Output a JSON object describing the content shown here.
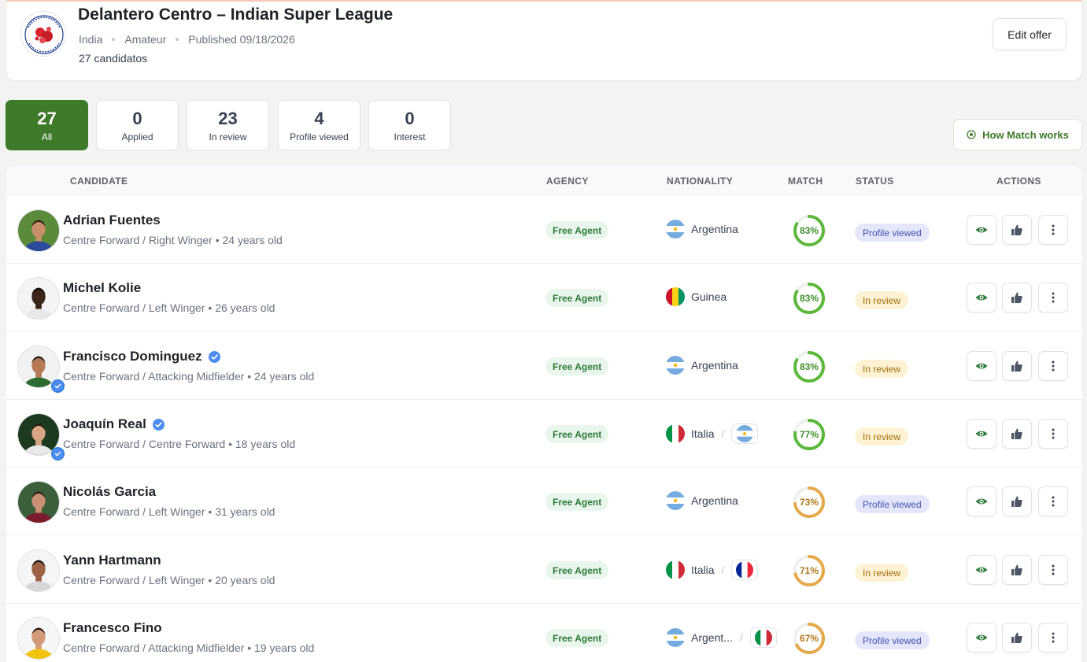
{
  "offer": {
    "title": "Delantero Centro – Indian Super League",
    "country": "India",
    "level": "Amateur",
    "published": "Published 09/18/2026",
    "candidates_count": "27 candidatos",
    "edit_label": "Edit offer",
    "logo_icon": "indian-super-league-logo"
  },
  "filters": [
    {
      "count": "27",
      "label": "All",
      "active": true
    },
    {
      "count": "0",
      "label": "Applied",
      "active": false
    },
    {
      "count": "23",
      "label": "In review",
      "active": false
    },
    {
      "count": "4",
      "label": "Profile viewed",
      "active": false
    },
    {
      "count": "0",
      "label": "Interest",
      "active": false
    }
  ],
  "how_match_label": "How Match works",
  "table": {
    "headers": {
      "candidate": "CANDIDATE",
      "agency": "AGENCY",
      "nationality": "NATIONALITY",
      "match": "MATCH",
      "status": "STATUS",
      "actions": "ACTIONS"
    },
    "rows": [
      {
        "name": "Adrian Fuentes",
        "subtitle": "Centre Forward / Right Winger • 24 years old",
        "verified": false,
        "agency": "Free Agent",
        "nationality": "Argentina",
        "flags": [
          "argentina"
        ],
        "match": "83%",
        "match_value": 83,
        "status": "Profile viewed",
        "status_type": "viewed"
      },
      {
        "name": "Michel Kolie",
        "subtitle": "Centre Forward / Left Winger • 26 years old",
        "verified": false,
        "agency": "Free Agent",
        "nationality": "Guinea",
        "flags": [
          "guinea"
        ],
        "match": "83%",
        "match_value": 83,
        "status": "In review",
        "status_type": "review"
      },
      {
        "name": "Francisco Dominguez",
        "subtitle": "Centre Forward / Attacking Midfielder • 24 years old",
        "verified": true,
        "agency": "Free Agent",
        "nationality": "Argentina",
        "flags": [
          "argentina"
        ],
        "match": "83%",
        "match_value": 83,
        "status": "In review",
        "status_type": "review"
      },
      {
        "name": "Joaquín Real",
        "subtitle": "Centre Forward / Centre Forward • 18 years old",
        "verified": true,
        "agency": "Free Agent",
        "nationality": "Italia",
        "flags": [
          "italy",
          "argentina"
        ],
        "match": "77%",
        "match_value": 77,
        "status": "In review",
        "status_type": "review"
      },
      {
        "name": "Nicolás Garcia",
        "subtitle": "Centre Forward / Left Winger • 31 years old",
        "verified": false,
        "agency": "Free Agent",
        "nationality": "Argentina",
        "flags": [
          "argentina"
        ],
        "match": "73%",
        "match_value": 73,
        "status": "Profile viewed",
        "status_type": "viewed"
      },
      {
        "name": "Yann Hartmann",
        "subtitle": "Centre Forward / Left Winger • 20 years old",
        "verified": false,
        "agency": "Free Agent",
        "nationality": "Italia",
        "flags": [
          "italy",
          "france"
        ],
        "match": "71%",
        "match_value": 71,
        "status": "In review",
        "status_type": "review"
      },
      {
        "name": "Francesco Fino",
        "subtitle": "Centre Forward / Attacking Midfielder • 19 years old",
        "verified": false,
        "agency": "Free Agent",
        "nationality": "Argent...",
        "flags": [
          "argentina",
          "italy"
        ],
        "match": "67%",
        "match_value": 67,
        "status": "Profile viewed",
        "status_type": "viewed"
      }
    ]
  },
  "colors": {
    "brand_green": "#3d7a2a",
    "match_high": "#5cb83a",
    "match_mid": "#e5a94a"
  },
  "row_actions": [
    "eye-icon",
    "thumbs-up-icon",
    "more-vertical-icon"
  ]
}
